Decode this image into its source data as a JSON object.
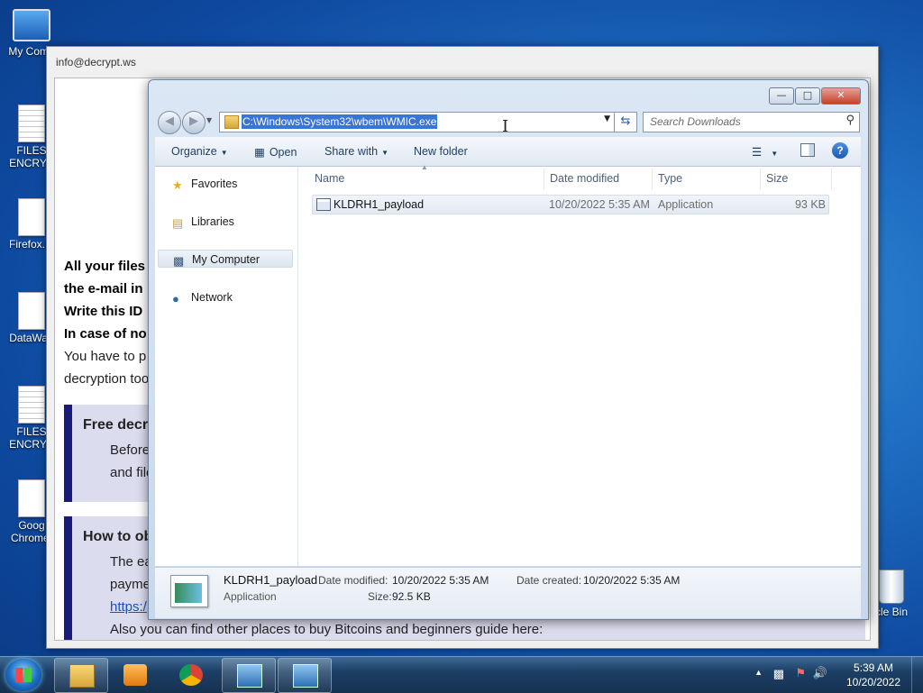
{
  "desktop": {
    "icons": [
      {
        "label": "My Comp"
      },
      {
        "label": "FILES\nENCRYP"
      },
      {
        "label": "Firefox.In"
      },
      {
        "label": "DataWag"
      },
      {
        "label": "FILES\nENCRYP"
      },
      {
        "label": "Goog\nChrome."
      },
      {
        "label": "cle Bin"
      }
    ]
  },
  "note": {
    "title": "info@decrypt.ws",
    "lines": [
      "All your files",
      "the e-mail  in",
      "Write this ID",
      "In case of no",
      "You have to p",
      "decryption too"
    ],
    "panel1": {
      "heading": "Free decr",
      "l1": "Before",
      "l2": "and file"
    },
    "panel2": {
      "heading": "How to ob",
      "l1": "The ea",
      "l2": "payme",
      "link": "https:/"
    },
    "footer_line": "Also you can find other places to buy Bitcoins and beginners guide here:"
  },
  "explorer": {
    "address": "C:\\Windows\\System32\\wbem\\WMIC.exe",
    "search_placeholder": "Search Downloads",
    "toolbar": {
      "organize": "Organize",
      "open": "Open",
      "share_with": "Share with",
      "new_folder": "New folder"
    },
    "nav": {
      "favorites": "Favorites",
      "libraries": "Libraries",
      "my_computer": "My Computer",
      "network": "Network"
    },
    "columns": {
      "name": "Name",
      "date_modified": "Date modified",
      "type": "Type",
      "size": "Size"
    },
    "files": [
      {
        "name": "KLDRH1_payload",
        "date_modified": "10/20/2022 5:35 AM",
        "type": "Application",
        "size": "93 KB"
      }
    ],
    "details": {
      "name": "KLDRH1_payload",
      "type": "Application",
      "date_modified_label": "Date modified:",
      "date_modified": "10/20/2022 5:35 AM",
      "date_created_label": "Date created:",
      "date_created": "10/20/2022 5:35 AM",
      "size_label": "Size:",
      "size": "92.5 KB"
    }
  },
  "taskbar": {
    "clock_time": "5:39 AM",
    "clock_date": "10/20/2022",
    "items": [
      "explorer-icon",
      "media-player-icon",
      "chrome-icon",
      "program-icon",
      "program-icon"
    ]
  }
}
